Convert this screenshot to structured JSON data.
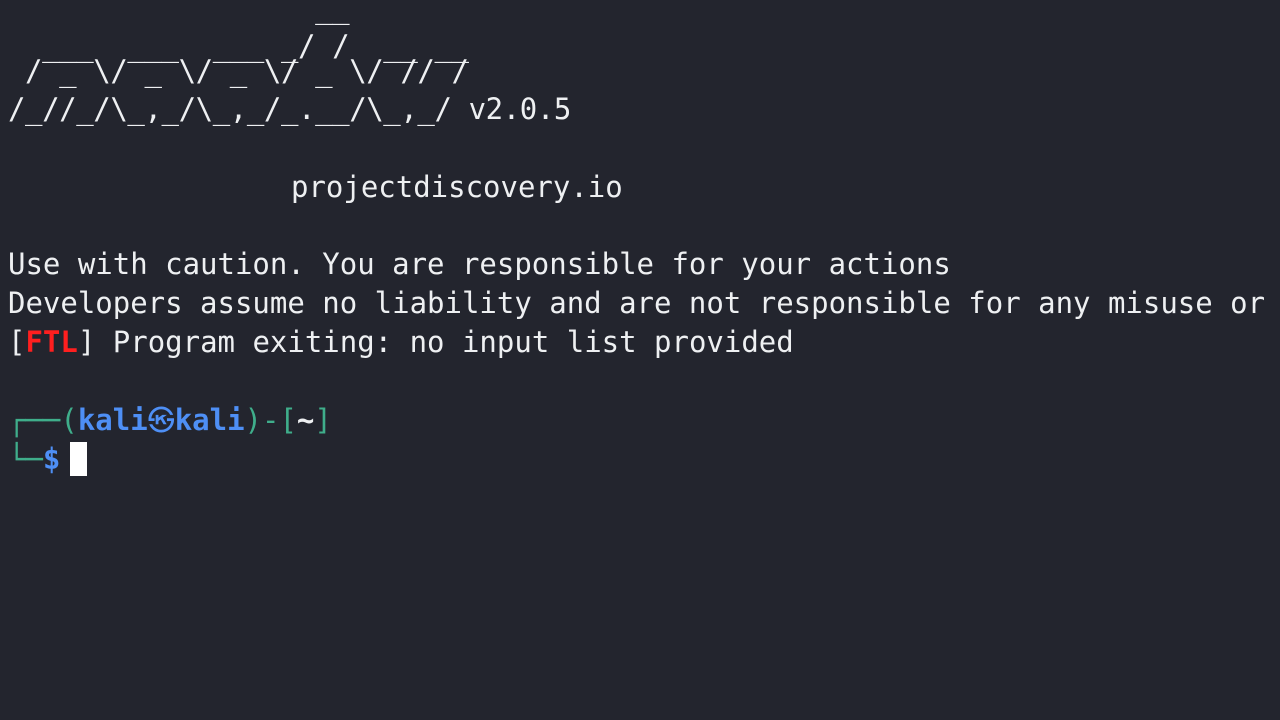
{
  "banner": {
    "lines": [
      "                  __",
      "  ___  ___  ___ _/ /  __ __",
      " / _ \\/ _ \\/ _ \\/ _ \\/ // /",
      "/_//_/\\_,_/\\_,_/_.__/\\_,_/"
    ],
    "version": "v2.0.5",
    "site": "projectdiscovery.io"
  },
  "messages": {
    "caution": "Use with caution. You are responsible for your actions",
    "liability": "Developers assume no liability and are not responsible for any misuse or",
    "error": {
      "open_bracket": "[",
      "level": "FTL",
      "close_bracket": "]",
      "text": " Program exiting: no input list provided"
    }
  },
  "prompt": {
    "top_corner": "┌──(",
    "user": "kali",
    "at_icon": "㉿",
    "host": "kali",
    "mid": ")-[",
    "cwd": "~",
    "end": "]",
    "bottom_corner": "└─",
    "symbol": "$"
  },
  "colors": {
    "background": "#23252e",
    "text": "#eef0f2",
    "error": "#ff1f1f",
    "frame": "#3fae8b",
    "prompt": "#4e8ff5"
  }
}
